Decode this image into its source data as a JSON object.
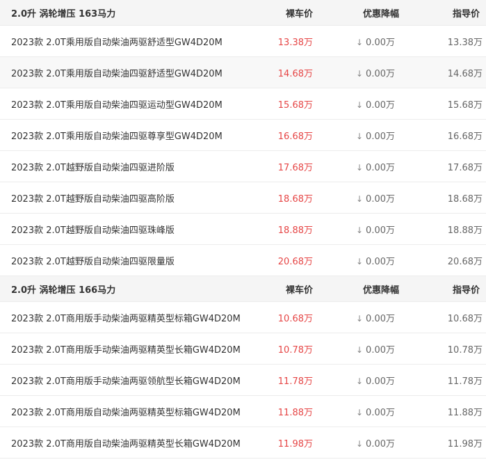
{
  "headers": {
    "bare_price": "裸车价",
    "discount": "优惠降幅",
    "guide_price": "指导价"
  },
  "groups": [
    {
      "title": "2.0升 涡轮增压 163马力",
      "rows": [
        {
          "name": "2023款 2.0T乘用版自动柴油两驱舒适型GW4D20M",
          "bare": "13.38万",
          "discount": "0.00万",
          "guide": "13.38万"
        },
        {
          "name": "2023款 2.0T乘用版自动柴油四驱舒适型GW4D20M",
          "bare": "14.68万",
          "discount": "0.00万",
          "guide": "14.68万"
        },
        {
          "name": "2023款 2.0T乘用版自动柴油四驱运动型GW4D20M",
          "bare": "15.68万",
          "discount": "0.00万",
          "guide": "15.68万"
        },
        {
          "name": "2023款 2.0T乘用版自动柴油四驱尊享型GW4D20M",
          "bare": "16.68万",
          "discount": "0.00万",
          "guide": "16.68万"
        },
        {
          "name": "2023款 2.0T越野版自动柴油四驱进阶版",
          "bare": "17.68万",
          "discount": "0.00万",
          "guide": "17.68万"
        },
        {
          "name": "2023款 2.0T越野版自动柴油四驱高阶版",
          "bare": "18.68万",
          "discount": "0.00万",
          "guide": "18.68万"
        },
        {
          "name": "2023款 2.0T越野版自动柴油四驱珠峰版",
          "bare": "18.88万",
          "discount": "0.00万",
          "guide": "18.88万"
        },
        {
          "name": "2023款 2.0T越野版自动柴油四驱限量版",
          "bare": "20.68万",
          "discount": "0.00万",
          "guide": "20.68万"
        }
      ]
    },
    {
      "title": "2.0升 涡轮增压 166马力",
      "rows": [
        {
          "name": "2023款 2.0T商用版手动柴油两驱精英型标箱GW4D20M",
          "bare": "10.68万",
          "discount": "0.00万",
          "guide": "10.68万"
        },
        {
          "name": "2023款 2.0T商用版手动柴油两驱精英型长箱GW4D20M",
          "bare": "10.78万",
          "discount": "0.00万",
          "guide": "10.78万"
        },
        {
          "name": "2023款 2.0T商用版手动柴油两驱领航型长箱GW4D20M",
          "bare": "11.78万",
          "discount": "0.00万",
          "guide": "11.78万"
        },
        {
          "name": "2023款 2.0T商用版自动柴油两驱精英型标箱GW4D20M",
          "bare": "11.88万",
          "discount": "0.00万",
          "guide": "11.88万"
        },
        {
          "name": "2023款 2.0T商用版自动柴油两驱精英型长箱GW4D20M",
          "bare": "11.98万",
          "discount": "0.00万",
          "guide": "11.98万"
        }
      ]
    }
  ],
  "colors": {
    "bare_price": "#e64545",
    "header_bg": "#f5f5f5",
    "alt_row_bg": "#f8f8f8"
  },
  "icons": {
    "discount_arrow": "down-arrow-icon"
  }
}
